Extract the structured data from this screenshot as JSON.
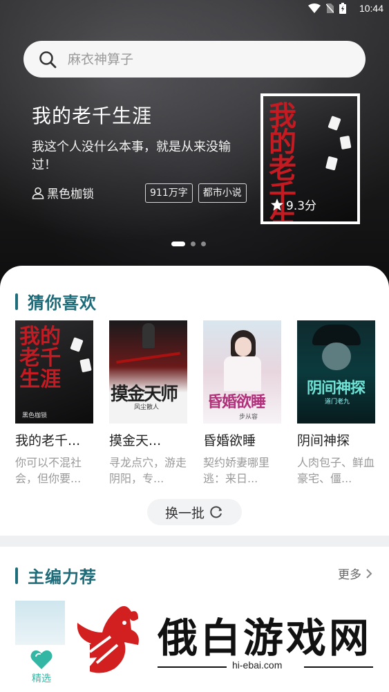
{
  "status_bar": {
    "time": "10:44"
  },
  "search": {
    "placeholder": "麻衣神算子"
  },
  "featured": {
    "title": "我的老千生涯",
    "description": "我这个人没什么本事，就是从来没输过！",
    "author": "黑色枷锁",
    "tags": [
      "911万字",
      "都市小说"
    ],
    "rating": "9.3分",
    "cover_text": "我的老千生涯"
  },
  "guess_section": {
    "title": "猜你喜欢",
    "books": [
      {
        "title": "我的老千...",
        "description": "你可以不混社会，但你要...",
        "cover_text": "我的老千生涯",
        "cover_author": "黑色枷锁"
      },
      {
        "title": "摸金天...",
        "description": "寻龙点穴，游走阴阳，专...",
        "cover_text": "摸金天师",
        "cover_author": "风尘散人"
      },
      {
        "title": "昏婚欲睡",
        "description": "契约娇妻哪里逃：来日...",
        "cover_text": "昏婚欲睡",
        "cover_author": "步从容"
      },
      {
        "title": "阴间神探",
        "description": "人肉包子、鲜血豪宅、僵...",
        "cover_text": "阴间神探",
        "cover_author": "道门老九"
      }
    ],
    "refresh_label": "换一批"
  },
  "editor_section": {
    "title": "主编力荐",
    "more_label": "更多"
  },
  "bottom_nav": {
    "active_label": "精选"
  },
  "watermark": {
    "text": "俄白游戏网",
    "url": "hi-ebai.com"
  },
  "colors": {
    "accent": "#1d6b78",
    "nav_active": "#33b7a4",
    "cover_red": "#c41a22"
  }
}
